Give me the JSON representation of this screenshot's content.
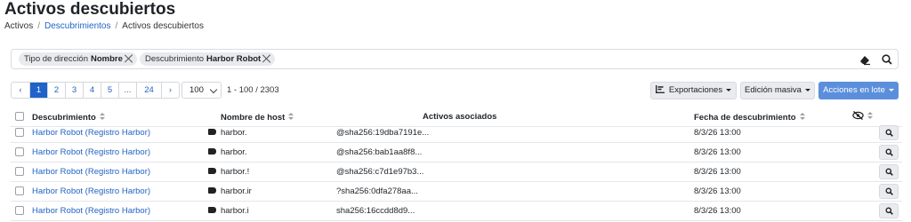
{
  "page": {
    "title": "Activos descubiertos",
    "breadcrumb": [
      "Activos",
      "Descubrimientos",
      "Activos descubiertos"
    ]
  },
  "filters": [
    {
      "label": "Tipo de dirección",
      "value": "Nombre"
    },
    {
      "label": "Descubrimiento",
      "value": "Harbor Robot"
    }
  ],
  "filter_icons": [
    "eraser-icon",
    "search-icon"
  ],
  "pagination": {
    "prev": "‹",
    "pages": [
      "1",
      "2",
      "3",
      "4",
      "5",
      "...",
      "24"
    ],
    "next": "›",
    "per_page": "100",
    "range": "1 - 100 / 2303"
  },
  "toolbar": {
    "exports": "Exportaciones",
    "bulk_edit": "Edición masiva",
    "batch_actions": "Acciones en lote"
  },
  "table": {
    "columns": [
      "Descubrimiento",
      "Nombre de host",
      "Activos asociados",
      "Fecha de descubrimiento"
    ],
    "rows": [
      {
        "discovery": "Harbor Robot (Registro Harbor)",
        "host": "harbor.",
        "asset": "@sha256:19dba7191e...",
        "date": "8/3/26 13:00"
      },
      {
        "discovery": "Harbor Robot (Registro Harbor)",
        "host": "harbor.",
        "asset": "@sha256:bab1aa8f8...",
        "date": "8/3/26 13:00"
      },
      {
        "discovery": "Harbor Robot (Registro Harbor)",
        "host": "harbor.!",
        "asset": "@sha256:c7d1e97b3...",
        "date": "8/3/26 13:00"
      },
      {
        "discovery": "Harbor Robot (Registro Harbor)",
        "host": "harbor.ir",
        "asset": "?sha256:0dfa278aa...",
        "date": "8/3/26 13:00"
      },
      {
        "discovery": "Harbor Robot (Registro Harbor)",
        "host": "harbor.i",
        "asset": "sha256:16ccdd8d9...",
        "date": "8/3/26 13:00"
      }
    ]
  },
  "colors": {
    "link": "#2264c4",
    "active_page": "#1f62c9",
    "primary_button": "#5b8fdc"
  }
}
